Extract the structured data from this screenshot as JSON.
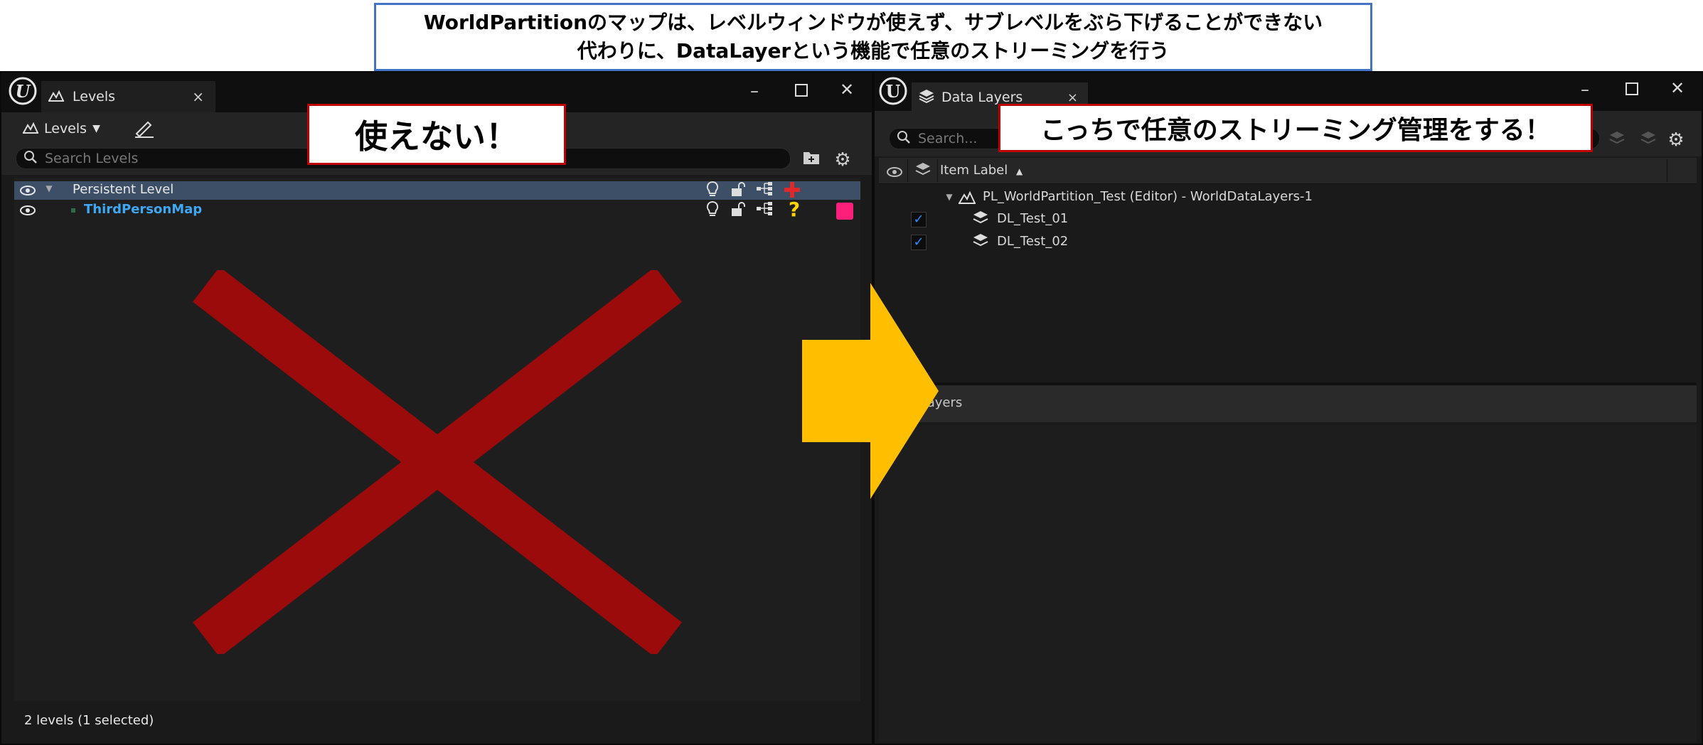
{
  "caption": {
    "line1": "WorldPartitionのマップは、レベルウィンドウが使えず、サブレベルをぶら下げることができない",
    "line2": "代わりに、DataLayerという機能で任意のストリーミングを行う"
  },
  "levels_window": {
    "tab_label": "Levels",
    "toolbar_label": "Levels",
    "search_placeholder": "Search Levels",
    "rows": [
      {
        "name": "Persistent Level"
      },
      {
        "name": "ThirdPersonMap"
      }
    ],
    "status": "2 levels (1 selected)",
    "callout": "使えない！"
  },
  "datalayers_window": {
    "tab_label": "Data Layers",
    "search_placeholder": "Search...",
    "column_header": "Item Label",
    "root": "PL_WorldPartition_Test (Editor) - WorldDataLayers-1",
    "layers": [
      {
        "name": "DL_Test_01",
        "checked": true
      },
      {
        "name": "DL_Test_02",
        "checked": true
      }
    ],
    "empty_text": "a layers",
    "callout": "こっちで任意のストリーミング管理をする！"
  },
  "colors": {
    "cross": "#9b0b0b",
    "arrow": "#ffbf00",
    "selected_row": "#3d4f66",
    "link_text": "#3ea8f5",
    "pink_swatch": "#ff1f7a"
  }
}
